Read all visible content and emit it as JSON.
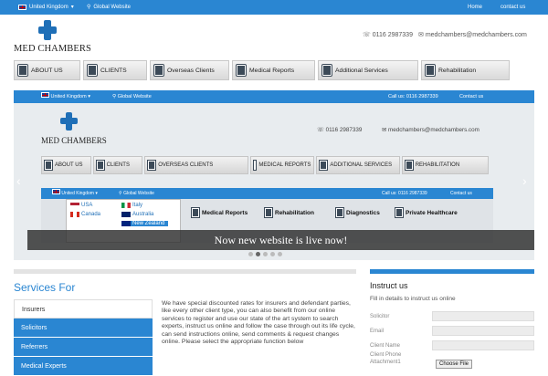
{
  "topbar": {
    "country": "United Kingdom",
    "global": "Global Website",
    "home": "Home",
    "contact": "contact us"
  },
  "brand": {
    "name": "MED CHAMBERS",
    "phone": "0116 2987339",
    "email": "medchambers@medchambers.com"
  },
  "nav": [
    {
      "label": "ABOUT US"
    },
    {
      "label": "CLIENTS"
    },
    {
      "label": "Overseas Clients"
    },
    {
      "label": "Medical Reports"
    },
    {
      "label": "Additional Services"
    },
    {
      "label": "Rehabilitation"
    }
  ],
  "slide": {
    "bar_country": "United Kingdom",
    "bar_global": "Global Website",
    "bar_call": "Call us: 0116 2987339",
    "bar_contact": "Contact us",
    "logo": "MED CHAMBERS",
    "phone": "0116 2987339",
    "email": "medchambers@medchambers.com",
    "nav": [
      "ABOUT US",
      "CLIENTS",
      "OVERSEAS CLIENTS",
      "MEDICAL REPORTS",
      "ADDITIONAL SERVICES",
      "REHABILITATION"
    ],
    "inner_country": "United Kingdom",
    "inner_global": "Global Website",
    "inner_call": "Call us: 0116 2987339",
    "inner_contact": "Contact us",
    "countries": [
      "USA",
      "Canada",
      "Italy",
      "Australia",
      "New Zealand"
    ],
    "services": [
      "Medical Reports",
      "Rehabilitation",
      "Diagnostics",
      "Private Healthcare"
    ],
    "caption": "Now new website is live now!",
    "dots_active": 1
  },
  "services": {
    "heading": "Services For",
    "items": [
      "Insurers",
      "Solicitors",
      "Referrers",
      "Medical Experts"
    ],
    "body": "We have special discounted rates for insurers and defendant parties, like every other client type, you can also benefit from our online services to register and use our state of the art system to search experts, instruct us online and follow the case through out its life cycle, can send instructions online, send comments & request changes online. Please select the appropriate function below"
  },
  "instruct": {
    "heading": "Instruct us",
    "sub": "Fill in details to instruct us online",
    "labels": [
      "Solicitor",
      "Email",
      "Client Name",
      "Client Phone",
      "Attachment1"
    ],
    "file_button": "Choose File"
  }
}
